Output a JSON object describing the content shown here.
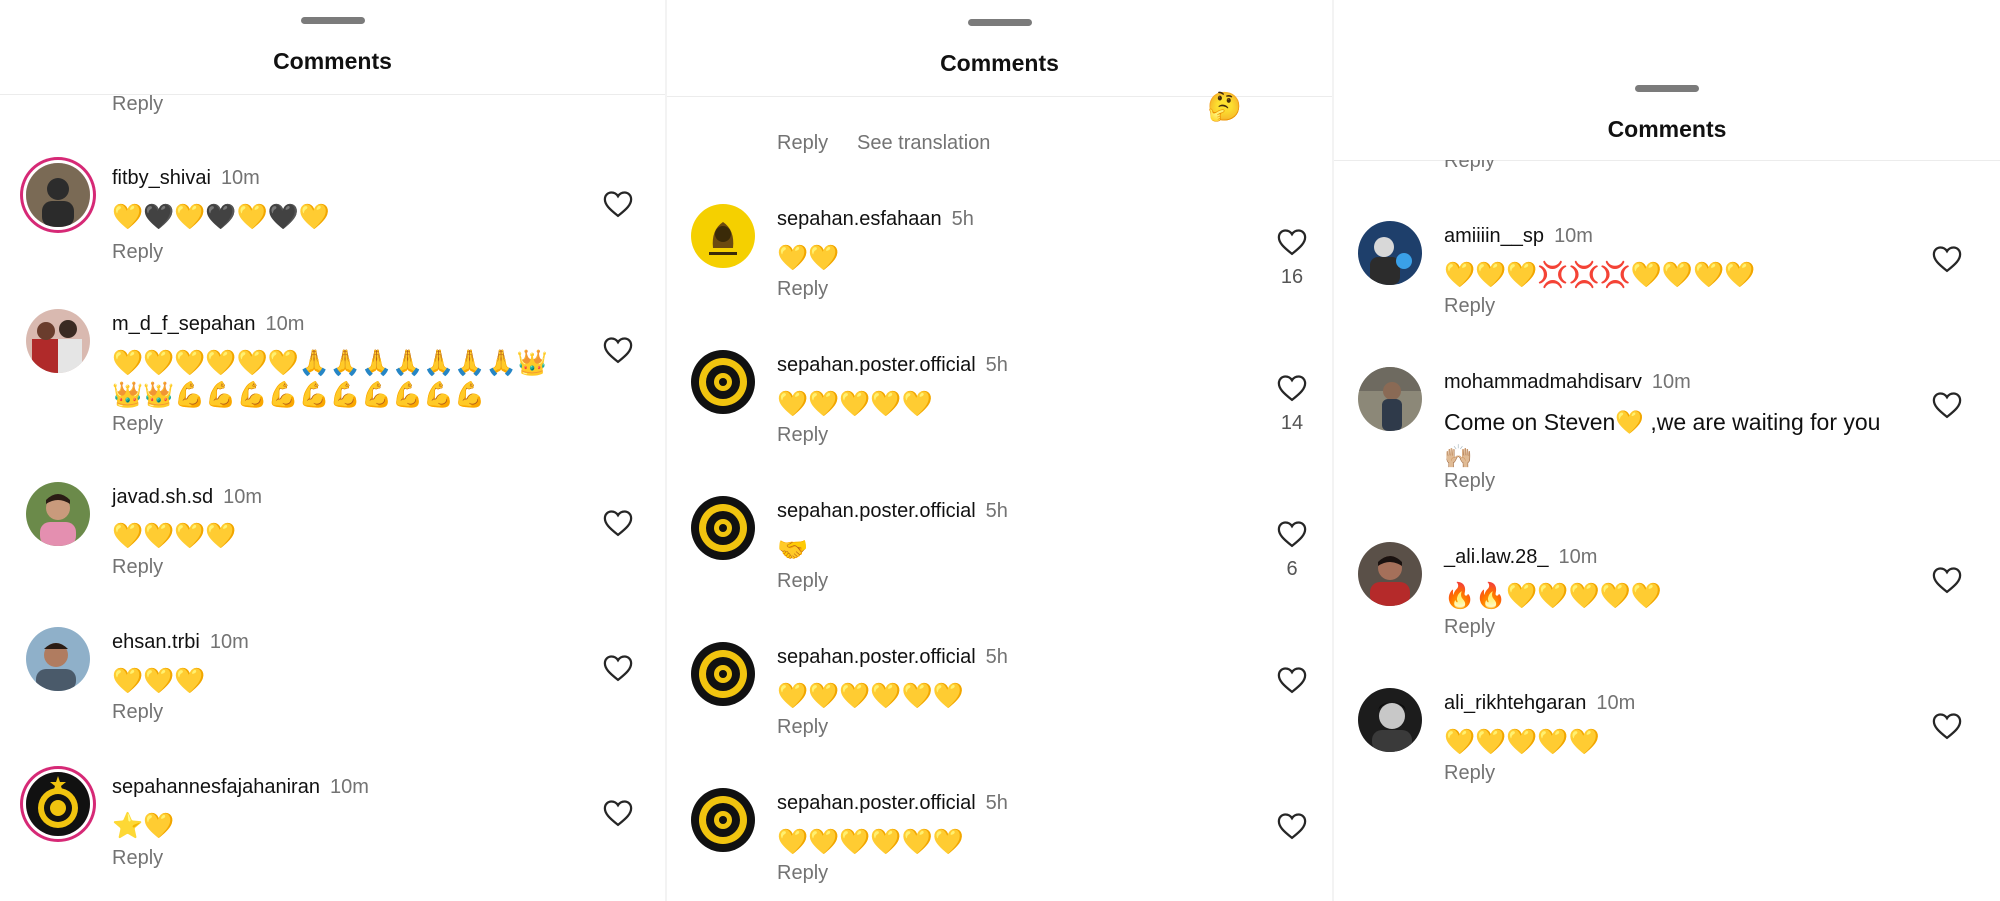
{
  "panels": [
    {
      "header_title": "Comments",
      "top_reply": "Reply",
      "comments": [
        {
          "username": "fitby_shivai",
          "time": "10m",
          "text": "💛🖤💛🖤💛🖤💛",
          "reply": "Reply",
          "avatar_color": "#7a6a55"
        },
        {
          "username": "m_d_f_sepahan",
          "time": "10m",
          "text": "💛💛💛💛💛💛🙏🙏🙏🙏🙏🙏🙏👑👑👑💪💪💪💪💪💪💪💪💪💪",
          "reply": "Reply",
          "avatar_color": "#a83a3a"
        },
        {
          "username": "javad.sh.sd",
          "time": "10m",
          "text": "💛💛💛💛",
          "reply": "Reply",
          "avatar_color": "#6b8a4a"
        },
        {
          "username": "ehsan.trbi",
          "time": "10m",
          "text": "💛💛💛",
          "reply": "Reply",
          "avatar_color": "#5d7a99"
        },
        {
          "username": "sepahannesfajahaniran",
          "time": "10m",
          "text": "⭐💛",
          "reply": "Reply",
          "avatar_color": "#1a1a1a"
        }
      ]
    },
    {
      "header_title": "Comments",
      "top_reply": "Reply",
      "top_translation": "See translation",
      "top_emoji": "🤔",
      "comments": [
        {
          "username": "sepahan.esfahaan",
          "time": "5h",
          "text": "💛💛",
          "reply": "Reply",
          "likes": "16",
          "avatar_color": "#f5d000"
        },
        {
          "username": "sepahan.poster.official",
          "time": "5h",
          "text": "💛💛💛💛💛",
          "reply": "Reply",
          "likes": "14",
          "avatar_color": "#111111"
        },
        {
          "username": "sepahan.poster.official",
          "time": "5h",
          "text": "🤝",
          "reply": "Reply",
          "likes": "6",
          "avatar_color": "#111111"
        },
        {
          "username": "sepahan.poster.official",
          "time": "5h",
          "text": "💛💛💛💛💛💛",
          "reply": "Reply",
          "likes": "",
          "avatar_color": "#111111"
        },
        {
          "username": "sepahan.poster.official",
          "time": "5h",
          "text": "💛💛💛💛💛💛",
          "reply": "Reply",
          "likes": "",
          "avatar_color": "#111111"
        }
      ]
    },
    {
      "header_title": "Comments",
      "top_reply": "Reply",
      "comments": [
        {
          "username": "amiiiin__sp",
          "time": "10m",
          "text": "💛💛💛💢💢💢💛💛💛💛",
          "reply": "Reply",
          "avatar_color": "#1e3f6b"
        },
        {
          "username": "mohammadmahdisarv",
          "time": "10m",
          "text": "Come on Steven💛 ,we are waiting for you 🙌🏼",
          "reply": "Reply",
          "avatar_color": "#6e6a60"
        },
        {
          "username": "_ali.law.28_",
          "time": "10m",
          "text": "🔥🔥💛💛💛💛💛",
          "reply": "Reply",
          "avatar_color": "#7a3b30"
        },
        {
          "username": "ali_rikhtehgaran",
          "time": "10m",
          "text": "💛💛💛💛💛",
          "reply": "Reply",
          "avatar_color": "#2a2a2a"
        }
      ]
    }
  ]
}
